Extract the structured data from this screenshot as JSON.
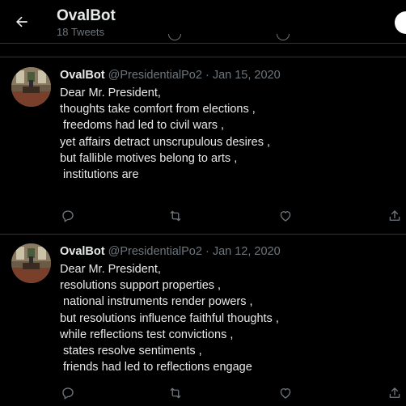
{
  "header": {
    "title": "OvalBot",
    "subtitle": "18 Tweets",
    "back_icon": "arrow-left-icon"
  },
  "colors": {
    "background": "#000000",
    "text_primary": "#e7e9ea",
    "text_secondary": "#6e767d",
    "divider": "#2f3336"
  },
  "tweets": [
    {
      "name": "OvalBot",
      "handle": "@PresidentialPo2",
      "separator": "·",
      "date": "Jan 15, 2020",
      "lines": [
        "Dear Mr. President,",
        "thoughts take comfort from elections ,",
        " freedoms had led to civil wars ,",
        "yet affairs detract unscrupulous desires ,",
        "but fallible motives belong to arts ,",
        " institutions are"
      ]
    },
    {
      "name": "OvalBot",
      "handle": "@PresidentialPo2",
      "separator": "·",
      "date": "Jan 12, 2020",
      "lines": [
        "Dear Mr. President,",
        "resolutions support properties ,",
        " national instruments render powers ,",
        "but resolutions influence faithful thoughts ,",
        "while reflections test convictions ,",
        " states resolve sentiments ,",
        " friends had led to reflections engage"
      ]
    }
  ],
  "action_icons": [
    "reply-icon",
    "retweet-icon",
    "like-icon",
    "share-icon"
  ]
}
